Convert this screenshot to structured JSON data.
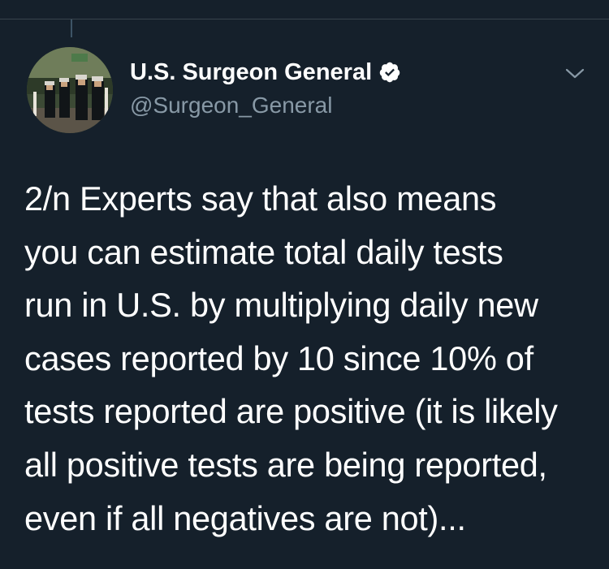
{
  "tweet": {
    "author": {
      "display_name": "U.S. Surgeon General",
      "handle": "@Surgeon_General",
      "verified": true,
      "avatar_icon": "ceremonial-salute-photo"
    },
    "text_lines": [
      "2/n Experts say that also means",
      "you can estimate total daily tests",
      "run in U.S. by multiplying daily new",
      "cases reported by 10 since 10% of",
      "tests reported are positive (it is likely",
      "all positive tests are being reported,",
      "even if all negatives are not)..."
    ],
    "menu_icon": "chevron-down-icon"
  },
  "theme": {
    "background": "#15202b",
    "text_primary": "#ffffff",
    "text_secondary": "#8899a6",
    "verified_badge": "#ffffff"
  }
}
